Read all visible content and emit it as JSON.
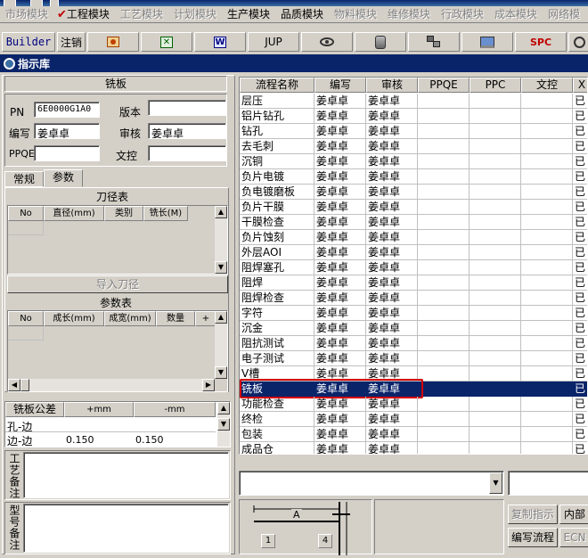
{
  "menu": {
    "items": [
      {
        "label": "市场模块",
        "enabled": false
      },
      {
        "label": "工程模块",
        "enabled": true,
        "checked": true
      },
      {
        "label": "工艺模块",
        "enabled": false
      },
      {
        "label": "计划模块",
        "enabled": false
      },
      {
        "label": "生产模块",
        "enabled": true
      },
      {
        "label": "品质模块",
        "enabled": true
      },
      {
        "label": "物料模块",
        "enabled": false
      },
      {
        "label": "维修模块",
        "enabled": false
      },
      {
        "label": "行政模块",
        "enabled": false
      },
      {
        "label": "成本模块",
        "enabled": false
      },
      {
        "label": "网络模",
        "enabled": false
      }
    ]
  },
  "toolbar": {
    "builder_label": "Builder",
    "logout_label": "注销",
    "jup_label": "JUP",
    "spc_label": "SPC",
    "icons": [
      "ppt-icon",
      "excel-icon",
      "word-icon",
      "eye-icon",
      "database-icon",
      "network-icon",
      "computer-icon",
      "power-icon"
    ]
  },
  "window": {
    "title": "指示库"
  },
  "form": {
    "section_title": "铣板",
    "pn_label": "PN",
    "pn_value": "6E0000G1A0",
    "version_label": "版本",
    "version_value": "",
    "author_label": "编写",
    "author_value": "姜卓卓",
    "reviewer_label": "审核",
    "reviewer_value": "姜卓卓",
    "ppqe_label": "PPQE",
    "ppqe_value": "",
    "doc_label": "文控",
    "doc_value": ""
  },
  "tabs": [
    {
      "label": "常规",
      "active": false
    },
    {
      "label": "参数",
      "active": true
    }
  ],
  "tool_table": {
    "title": "刀径表",
    "headers": [
      "No",
      "直径(mm)",
      "类别",
      "铣长(M)"
    ],
    "import_button": "导入刀径"
  },
  "param_table": {
    "title": "参数表",
    "headers": [
      "No",
      "成长(mm)",
      "成宽(mm)",
      "数量",
      "+"
    ]
  },
  "tolerance_table": {
    "headers": [
      "铣板公差",
      "+mm",
      "-mm"
    ],
    "rows": [
      {
        "name": "孔-边",
        "plus": "",
        "minus": ""
      },
      {
        "name": "边-边",
        "plus": "0.150",
        "minus": "0.150"
      }
    ]
  },
  "notes": {
    "process_label": "工艺备注",
    "type_label": "型号备注"
  },
  "process_grid": {
    "headers": [
      "流程名称",
      "编写",
      "审核",
      "PPQE",
      "PPC",
      "文控",
      "X"
    ],
    "rows": [
      {
        "name": "层压",
        "author": "姜卓卓",
        "reviewer": "姜卓卓",
        "status": "已"
      },
      {
        "name": "铝片钻孔",
        "author": "姜卓卓",
        "reviewer": "姜卓卓",
        "status": "已"
      },
      {
        "name": "钻孔",
        "author": "姜卓卓",
        "reviewer": "姜卓卓",
        "status": "已"
      },
      {
        "name": "去毛刺",
        "author": "姜卓卓",
        "reviewer": "姜卓卓",
        "status": "已"
      },
      {
        "name": "沉铜",
        "author": "姜卓卓",
        "reviewer": "姜卓卓",
        "status": "已"
      },
      {
        "name": "负片电镀",
        "author": "姜卓卓",
        "reviewer": "姜卓卓",
        "status": "已"
      },
      {
        "name": "负电镀磨板",
        "author": "姜卓卓",
        "reviewer": "姜卓卓",
        "status": "已"
      },
      {
        "name": "负片干膜",
        "author": "姜卓卓",
        "reviewer": "姜卓卓",
        "status": "已"
      },
      {
        "name": "干膜检查",
        "author": "姜卓卓",
        "reviewer": "姜卓卓",
        "status": "已"
      },
      {
        "name": "负片蚀刻",
        "author": "姜卓卓",
        "reviewer": "姜卓卓",
        "status": "已"
      },
      {
        "name": "外层AOI",
        "author": "姜卓卓",
        "reviewer": "姜卓卓",
        "status": "已"
      },
      {
        "name": "阻焊塞孔",
        "author": "姜卓卓",
        "reviewer": "姜卓卓",
        "status": "已"
      },
      {
        "name": "阻焊",
        "author": "姜卓卓",
        "reviewer": "姜卓卓",
        "status": "已"
      },
      {
        "name": "阻焊检查",
        "author": "姜卓卓",
        "reviewer": "姜卓卓",
        "status": "已"
      },
      {
        "name": "字符",
        "author": "姜卓卓",
        "reviewer": "姜卓卓",
        "status": "已"
      },
      {
        "name": "沉金",
        "author": "姜卓卓",
        "reviewer": "姜卓卓",
        "status": "已"
      },
      {
        "name": "阻抗测试",
        "author": "姜卓卓",
        "reviewer": "姜卓卓",
        "status": "已"
      },
      {
        "name": "电子测试",
        "author": "姜卓卓",
        "reviewer": "姜卓卓",
        "status": "已"
      },
      {
        "name": "V槽",
        "author": "姜卓卓",
        "reviewer": "姜卓卓",
        "status": "已"
      },
      {
        "name": "铣板",
        "author": "姜卓卓",
        "reviewer": "姜卓卓",
        "status": "已",
        "selected": true
      },
      {
        "name": "功能检查",
        "author": "姜卓卓",
        "reviewer": "姜卓卓",
        "status": "已"
      },
      {
        "name": "终检",
        "author": "姜卓卓",
        "reviewer": "姜卓卓",
        "status": "已"
      },
      {
        "name": "包装",
        "author": "姜卓卓",
        "reviewer": "姜卓卓",
        "status": "已"
      },
      {
        "name": "成品仓",
        "author": "姜卓卓",
        "reviewer": "姜卓卓",
        "status": "已"
      }
    ]
  },
  "bottom": {
    "diagram_letter": "A",
    "diagram_box1": "1",
    "diagram_box4": "4",
    "copy_button": "复制指示",
    "internal_button": "内部",
    "edit_flow_button": "编写流程",
    "ecn_button": "ECN"
  },
  "colors": {
    "selection": "#0a246a",
    "highlight_border": "#d40000",
    "title_bar": "#0a246a"
  }
}
